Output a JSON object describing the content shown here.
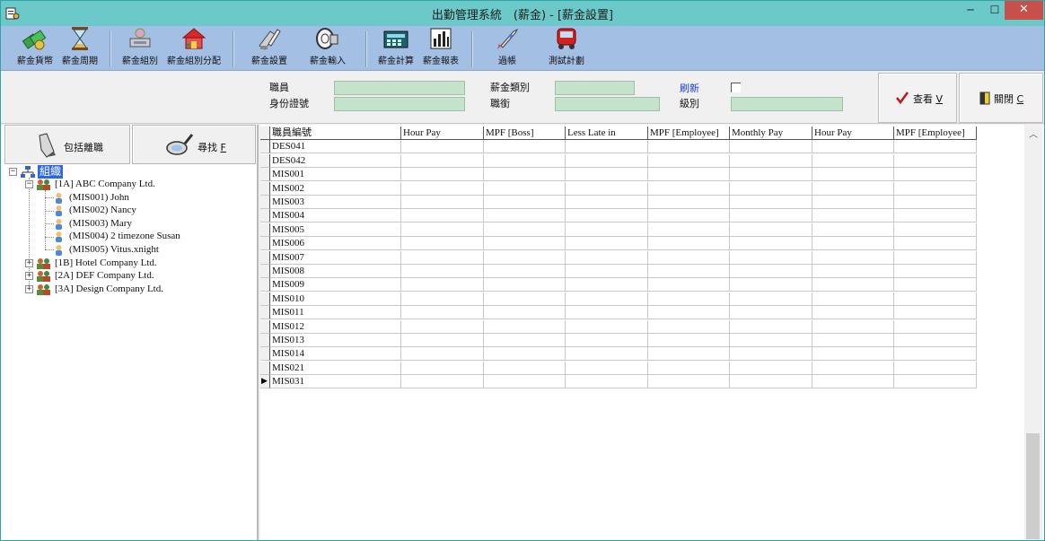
{
  "window": {
    "title": "出勤管理系統　(薪金) - [薪金設置]",
    "controls": {
      "minimize": "─",
      "maximize": "☐",
      "close": "✕"
    }
  },
  "toolbar": {
    "items": [
      {
        "label": "薪金貨幣",
        "icon": "currency-icon"
      },
      {
        "label": "薪金周期",
        "icon": "hourglass-icon"
      },
      {
        "label": "薪金組別",
        "icon": "salary-group-icon"
      },
      {
        "label": "薪金組別分配",
        "icon": "group-assign-icon"
      },
      {
        "label": "薪金設置",
        "icon": "salary-settings-icon"
      },
      {
        "label": "薪金輸入",
        "icon": "salary-input-icon"
      },
      {
        "label": "薪金計算",
        "icon": "calculator-icon"
      },
      {
        "label": "薪金報表",
        "icon": "report-icon"
      },
      {
        "label": "過帳",
        "icon": "rocket-icon"
      },
      {
        "label": "測試計劃",
        "icon": "test-plan-icon"
      }
    ]
  },
  "filter": {
    "employee_label": "職員",
    "id_label": "身份證號",
    "salary_type_label": "薪金類別",
    "position_label": "職銜",
    "refresh_label": "刷新",
    "level_label": "級別",
    "view_button": "查看",
    "view_hotkey": "V",
    "close_button": "關閉",
    "close_hotkey": "C"
  },
  "leftpane": {
    "include_resigned": "包括離職",
    "find_button": "尋找",
    "find_hotkey": "F",
    "tree": {
      "root": "組織",
      "companies": [
        {
          "label": "[1A]  ABC Company Ltd.",
          "expanded": true,
          "employees": [
            "(MIS001)  John",
            "(MIS002)  Nancy",
            "(MIS003)  Mary",
            "(MIS004)  2 timezone Susan",
            "(MIS005)  Vitus.xnight"
          ]
        },
        {
          "label": "[1B]  Hotel Company Ltd.",
          "expanded": false
        },
        {
          "label": "[2A]  DEF Company Ltd.",
          "expanded": false
        },
        {
          "label": "[3A]  Design Company Ltd.",
          "expanded": false
        }
      ]
    }
  },
  "grid": {
    "columns": [
      "職員編號",
      "Hour Pay",
      "MPF [Boss]",
      "Less Late in",
      "MPF [Employee]",
      "Monthly Pay",
      "Hour Pay",
      "MPF [Employee]"
    ],
    "rows": [
      "DES041",
      "DES042",
      "MIS001",
      "MIS002",
      "MIS003",
      "MIS004",
      "MIS005",
      "MIS006",
      "MIS007",
      "MIS008",
      "MIS009",
      "MIS010",
      "MIS011",
      "MIS012",
      "MIS013",
      "MIS014",
      "MIS021",
      "MIS031"
    ],
    "current_row_marker": "▶"
  }
}
